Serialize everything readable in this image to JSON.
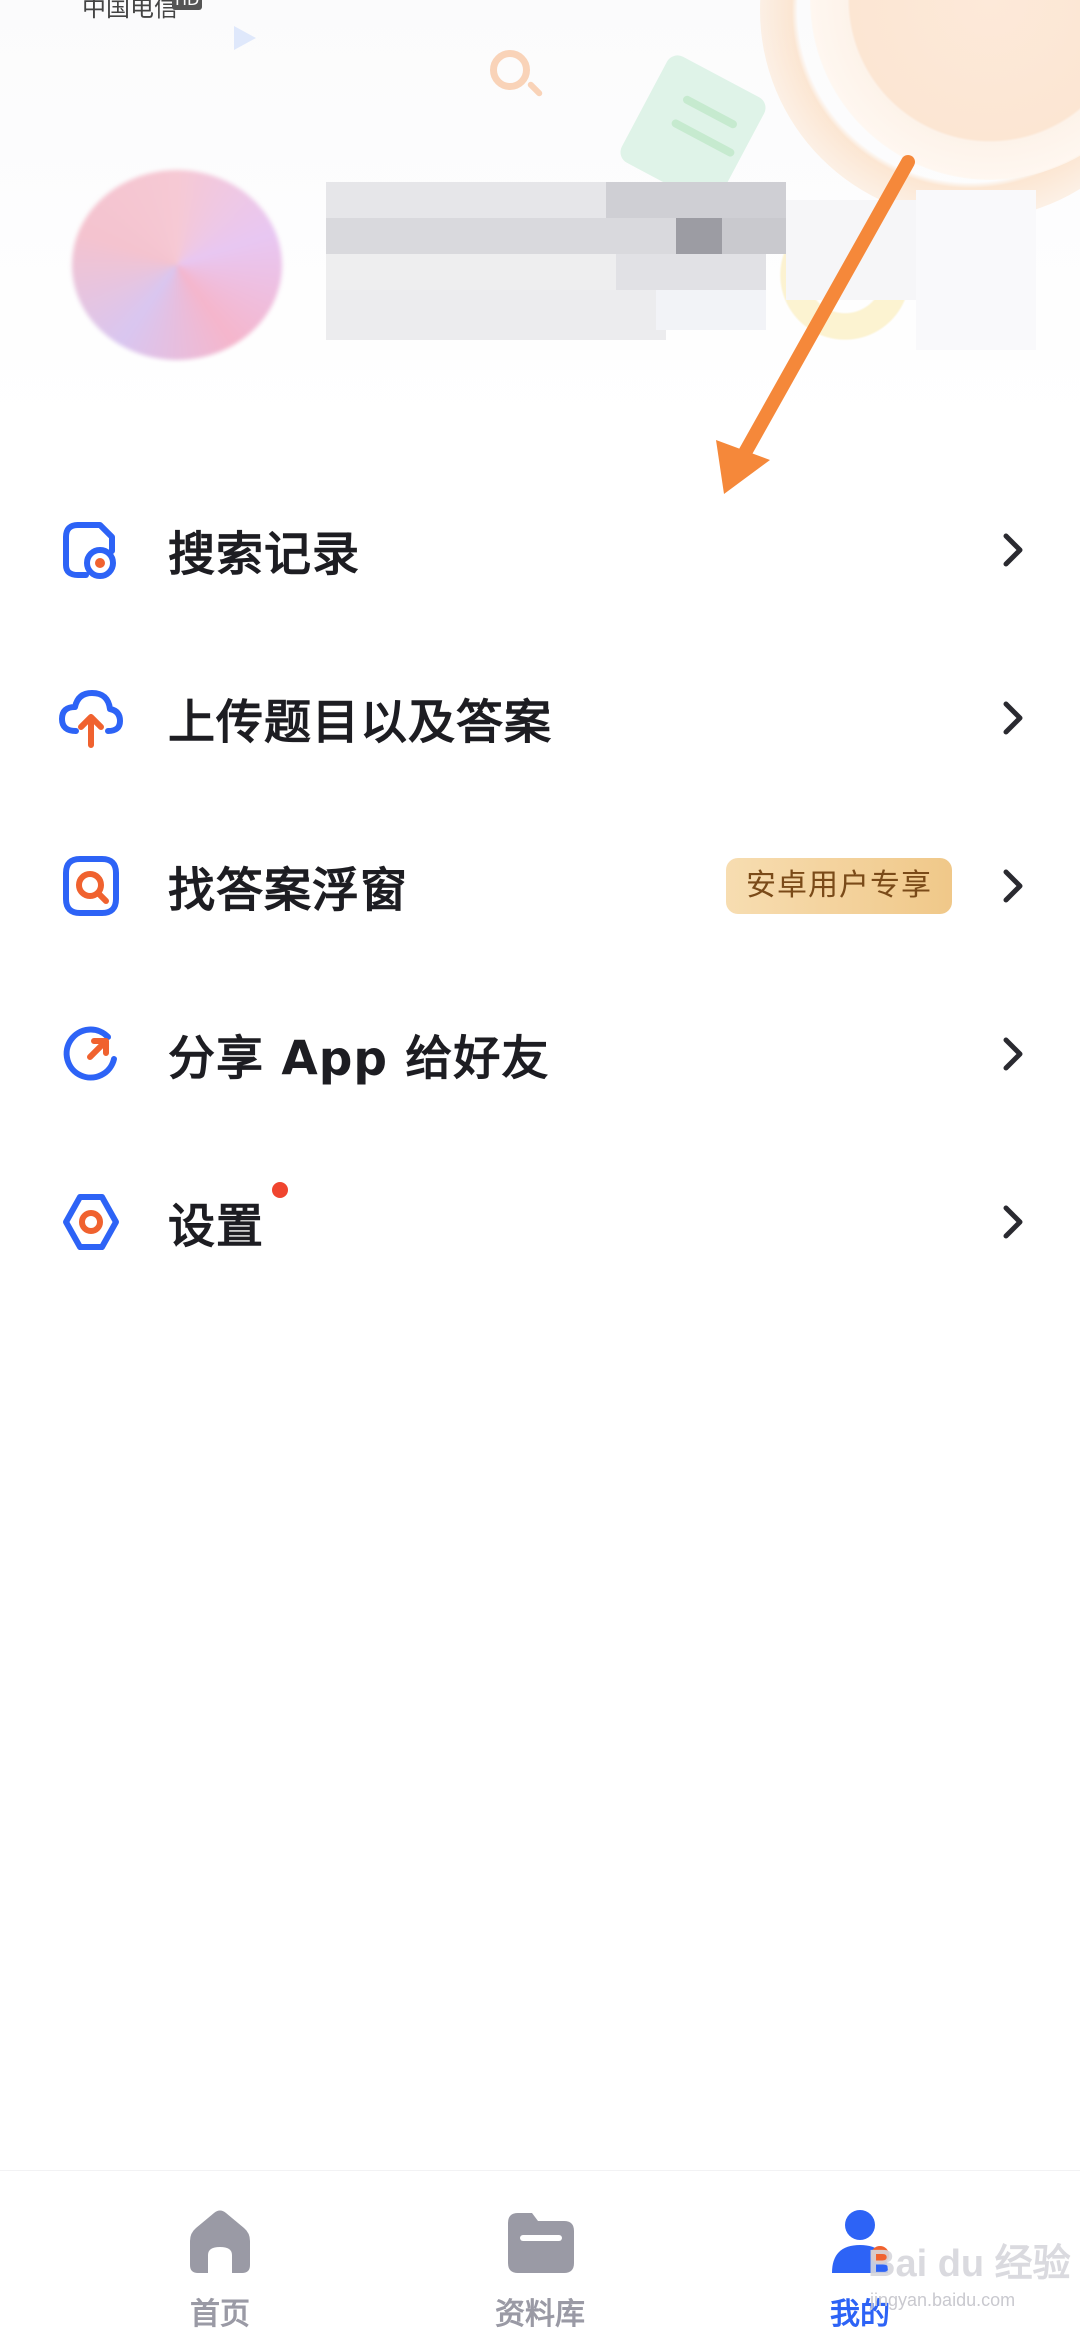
{
  "status_bar": {
    "carrier": "中国电信",
    "network_badge": "HD"
  },
  "profile": {
    "avatar_icon": "avatar-blurred",
    "name_blurred": true
  },
  "annotation": {
    "arrow_color": "#f5883a"
  },
  "menu": {
    "items": [
      {
        "icon": "search-history-icon",
        "label": "搜索记录"
      },
      {
        "icon": "upload-cloud-icon",
        "label": "上传题目以及答案"
      },
      {
        "icon": "floating-search-icon",
        "label": "找答案浮窗",
        "badge": "安卓用户专享"
      },
      {
        "icon": "share-icon",
        "label": "分享 App 给好友"
      },
      {
        "icon": "settings-icon",
        "label": "设置",
        "has_dot": true
      }
    ]
  },
  "tabbar": {
    "tabs": [
      {
        "icon": "home-icon",
        "label": "首页",
        "active": false
      },
      {
        "icon": "folder-icon",
        "label": "资料库",
        "active": false
      },
      {
        "icon": "profile-icon",
        "label": "我的",
        "active": true
      }
    ]
  },
  "watermark": {
    "text": "Bai du 经验",
    "url": "jingyan.baidu.com"
  },
  "colors": {
    "accent_blue": "#2d63f6",
    "accent_orange": "#f0622f",
    "badge_bg": "#f2cf93",
    "badge_text": "#7a4a18",
    "red_dot": "#f0452f"
  }
}
